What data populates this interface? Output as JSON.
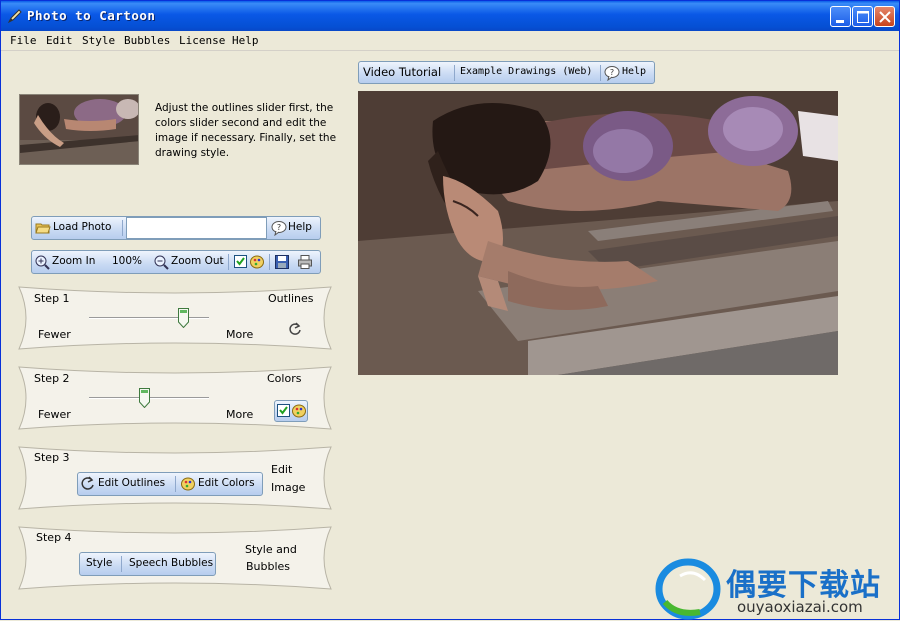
{
  "window": {
    "title": "Photo to Cartoon"
  },
  "menu": [
    "File",
    "Edit",
    "Style",
    "Bubbles",
    "License",
    "Help"
  ],
  "intro_text": "Adjust the outlines slider first, the colors slider second and edit the image if necessary. Finally, set the drawing style.",
  "load_toolbar": {
    "load_label": "Load Photo",
    "file_value": "",
    "help_label": "Help"
  },
  "zoom_toolbar": {
    "zoom_in_label": "Zoom In",
    "zoom_level": "100%",
    "zoom_out_label": "Zoom Out"
  },
  "step1": {
    "step_label": "Step 1",
    "title": "Outlines",
    "fewer_label": "Fewer",
    "more_label": "More",
    "slider_value": 0.79
  },
  "step2": {
    "step_label": "Step 2",
    "title": "Colors",
    "fewer_label": "Fewer",
    "more_label": "More",
    "slider_value": 0.46,
    "checkbox_checked": true
  },
  "step3": {
    "step_label": "Step 3",
    "edit_outlines_label": "Edit Outlines",
    "edit_colors_label": "Edit Colors",
    "title_line1": "Edit",
    "title_line2": "Image"
  },
  "step4": {
    "step_label": "Step 4",
    "style_label": "Style",
    "speech_bubbles_label": "Speech Bubbles",
    "title_line1": "Style and",
    "title_line2": "Bubbles"
  },
  "top_toolbar": {
    "video_tutorial_label": "Video Tutorial",
    "example_drawings_label": "Example Drawings (Web)",
    "help_label": "Help"
  },
  "watermark": {
    "chinese_text": "偶要下载站",
    "url_text": "ouyaoxiazai.com"
  },
  "colors": {
    "titlebar": "#0a58e6",
    "toolbar": "#c9daf3",
    "window_bg": "#ece9d8"
  }
}
